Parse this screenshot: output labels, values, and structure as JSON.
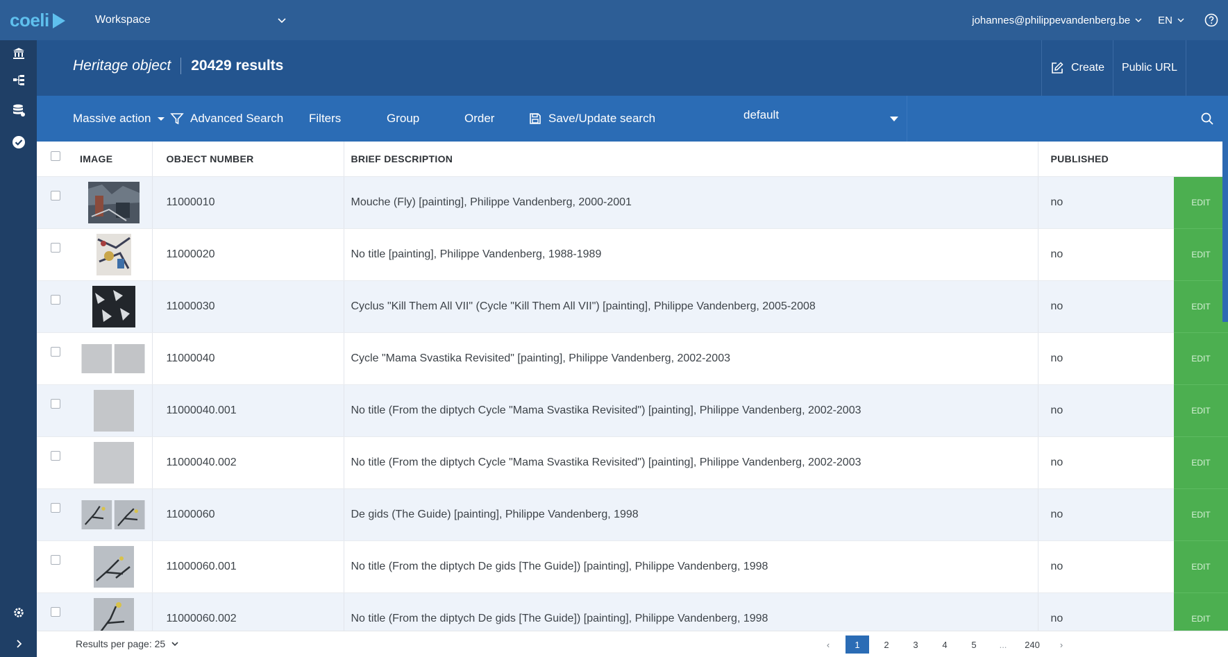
{
  "topbar": {
    "logo": "coeli",
    "workspace": "Workspace",
    "user": "johannes@philippevandenberg.be",
    "language": "EN"
  },
  "header": {
    "type": "Heritage object",
    "count": "20429 results",
    "create_label": "Create",
    "public_url_label": "Public URL"
  },
  "toolbar": {
    "massive_action": "Massive action",
    "advanced_search": "Advanced Search",
    "filters": "Filters",
    "group": "Group",
    "order": "Order",
    "save_search": "Save/Update search",
    "search_select": "default"
  },
  "table": {
    "columns": {
      "image": "IMAGE",
      "object_number": "OBJECT NUMBER",
      "brief_description": "BRIEF DESCRIPTION",
      "published": "PUBLISHED"
    },
    "edit_label": "EDIT",
    "rows": [
      {
        "number": "11000010",
        "description": "Mouche (Fly) [painting], Philippe Vandenberg, 2000-2001",
        "published": "no",
        "thumb": "dark-abstract"
      },
      {
        "number": "11000020",
        "description": "No title [painting], Philippe Vandenberg, 1988-1989",
        "published": "no",
        "thumb": "colorful-abstract"
      },
      {
        "number": "11000030",
        "description": "Cyclus \"Kill Them All VII\" (Cycle \"Kill Them All VII\") [painting], Philippe Vandenberg, 2005-2008",
        "published": "no",
        "thumb": "black-white-pattern"
      },
      {
        "number": "11000040",
        "description": "Cycle \"Mama Svastika Revisited\" [painting], Philippe Vandenberg, 2002-2003",
        "published": "no",
        "thumb": "grey-diptych"
      },
      {
        "number": "11000040.001",
        "description": "No title (From the diptych Cycle \"Mama Svastika Revisited\") [painting], Philippe Vandenberg, 2002-2003",
        "published": "no",
        "thumb": "grey-panel"
      },
      {
        "number": "11000040.002",
        "description": "No title (From the diptych Cycle \"Mama Svastika Revisited\") [painting], Philippe Vandenberg, 2002-2003",
        "published": "no",
        "thumb": "grey-panel"
      },
      {
        "number": "11000060",
        "description": "De gids (The Guide) [painting], Philippe Vandenberg, 1998",
        "published": "no",
        "thumb": "branch-diptych"
      },
      {
        "number": "11000060.001",
        "description": "No title (From the diptych De gids [The Guide]) [painting], Philippe Vandenberg, 1998",
        "published": "no",
        "thumb": "branch-panel"
      },
      {
        "number": "11000060.002",
        "description": "No title (From the diptych De gids [The Guide]) [painting], Philippe Vandenberg, 1998",
        "published": "no",
        "thumb": "branch-panel-2"
      }
    ]
  },
  "footer": {
    "results_per_page": "Results per page: 25",
    "pages": [
      "1",
      "2",
      "3",
      "4",
      "5",
      "...",
      "240"
    ],
    "prev": "‹",
    "next": "›"
  },
  "colors": {
    "topbar": "#2d5e96",
    "sidebar": "#1f3f66",
    "header": "#24558f",
    "toolbar": "#2b6cb5",
    "logo": "#5fc0ee",
    "edit": "#4caf50",
    "row_alt": "#eef3fa"
  },
  "icons": {
    "sidebar": [
      "museum-icon",
      "tree-icon",
      "database-icon",
      "check-circle-icon"
    ],
    "sidebar_bottom": "gear-icon",
    "toolbar": [
      "filter-icon",
      "save-icon",
      "search-icon"
    ],
    "header": [
      "edit-icon"
    ],
    "top": [
      "chevron-down-icon",
      "help-icon"
    ]
  }
}
